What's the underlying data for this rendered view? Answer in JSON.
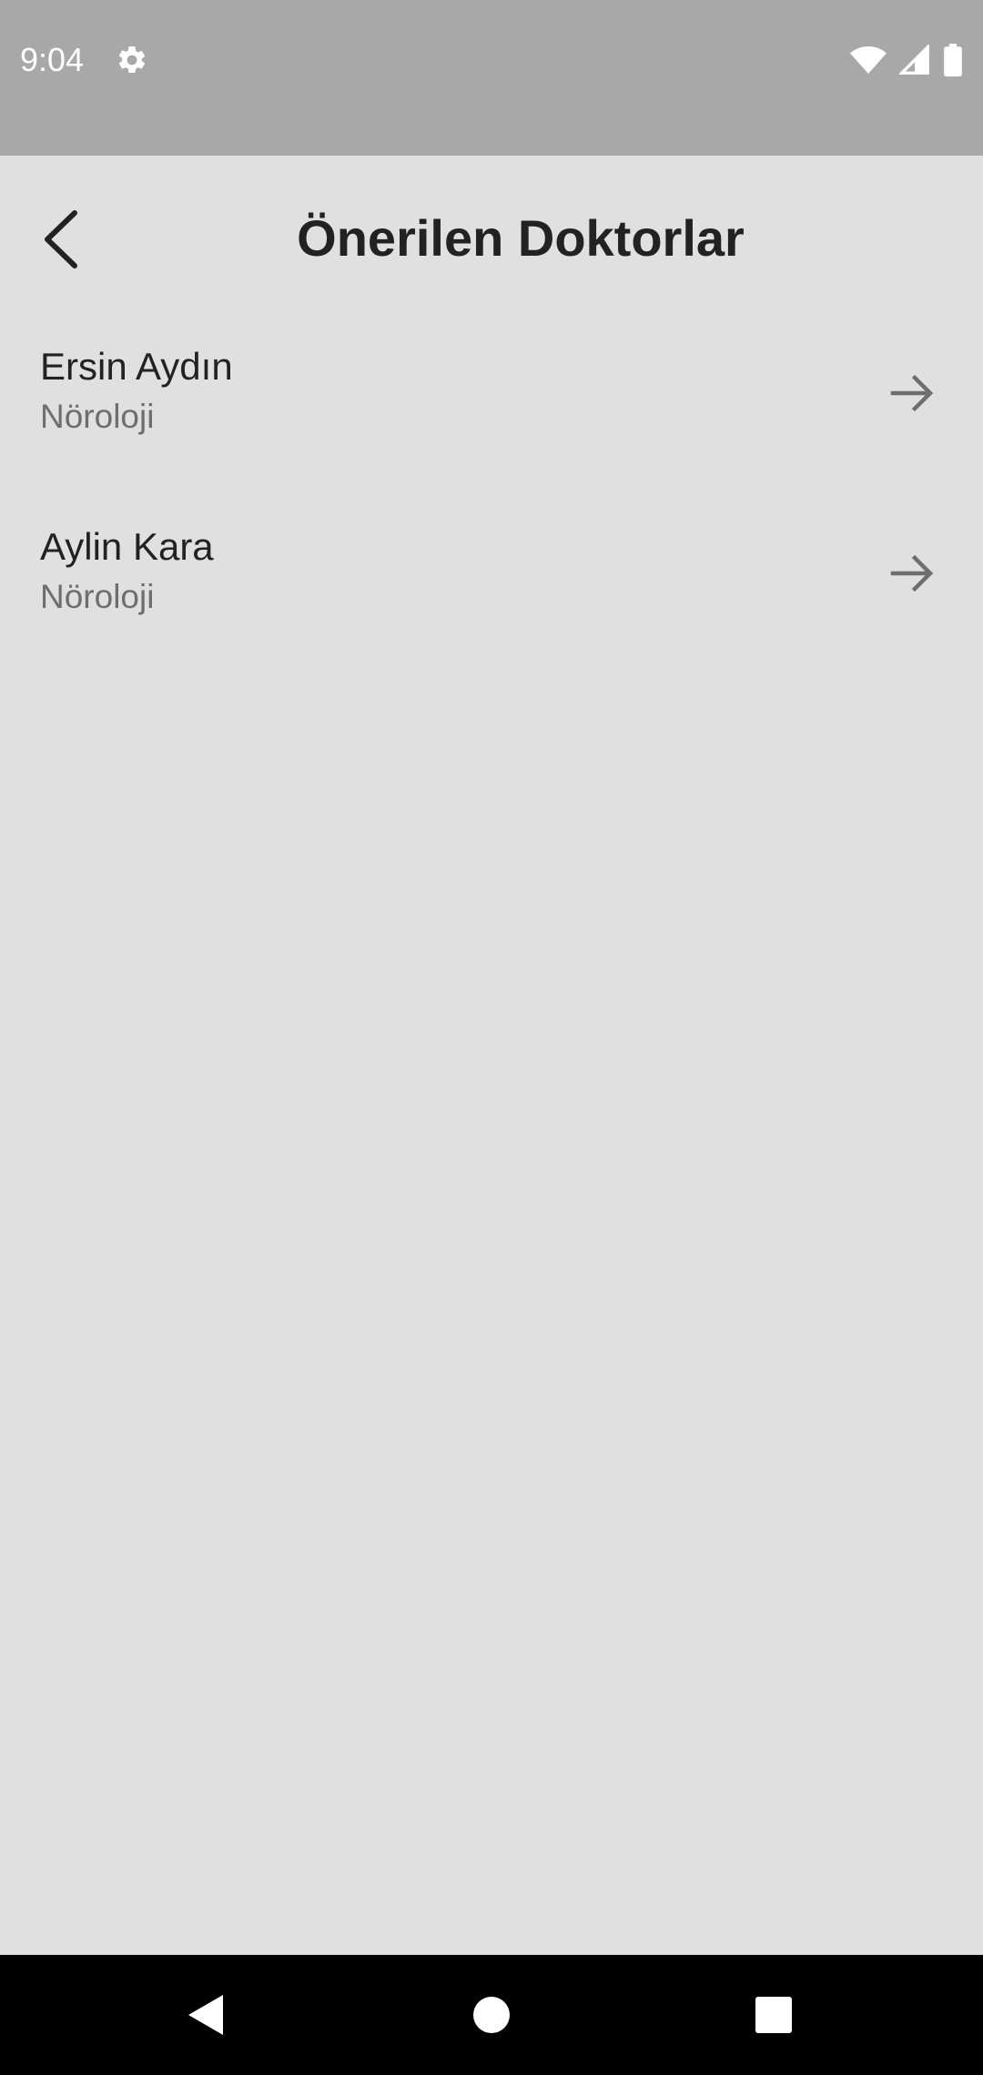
{
  "status_bar": {
    "time": "9:04",
    "left_icons": [
      "gear-icon"
    ],
    "right_icons": [
      "wifi-icon",
      "signal-icon",
      "battery-icon"
    ]
  },
  "app_bar": {
    "title": "Önerilen Doktorlar",
    "back_icon": "chevron-left-icon"
  },
  "doctors": [
    {
      "name": "Ersin Aydın",
      "specialty": "Nöroloji",
      "icon": "arrow-right-icon"
    },
    {
      "name": "Aylin Kara",
      "specialty": "Nöroloji",
      "icon": "arrow-right-icon"
    }
  ],
  "nav_bar": {
    "buttons": [
      "back-triangle-icon",
      "home-circle-icon",
      "recents-square-icon"
    ]
  },
  "colors": {
    "status_bar": "#a8a8a8",
    "background": "#e0e0e0",
    "title_text": "#222222",
    "secondary_text": "#6e6e6e",
    "nav_bar": "#000000"
  }
}
